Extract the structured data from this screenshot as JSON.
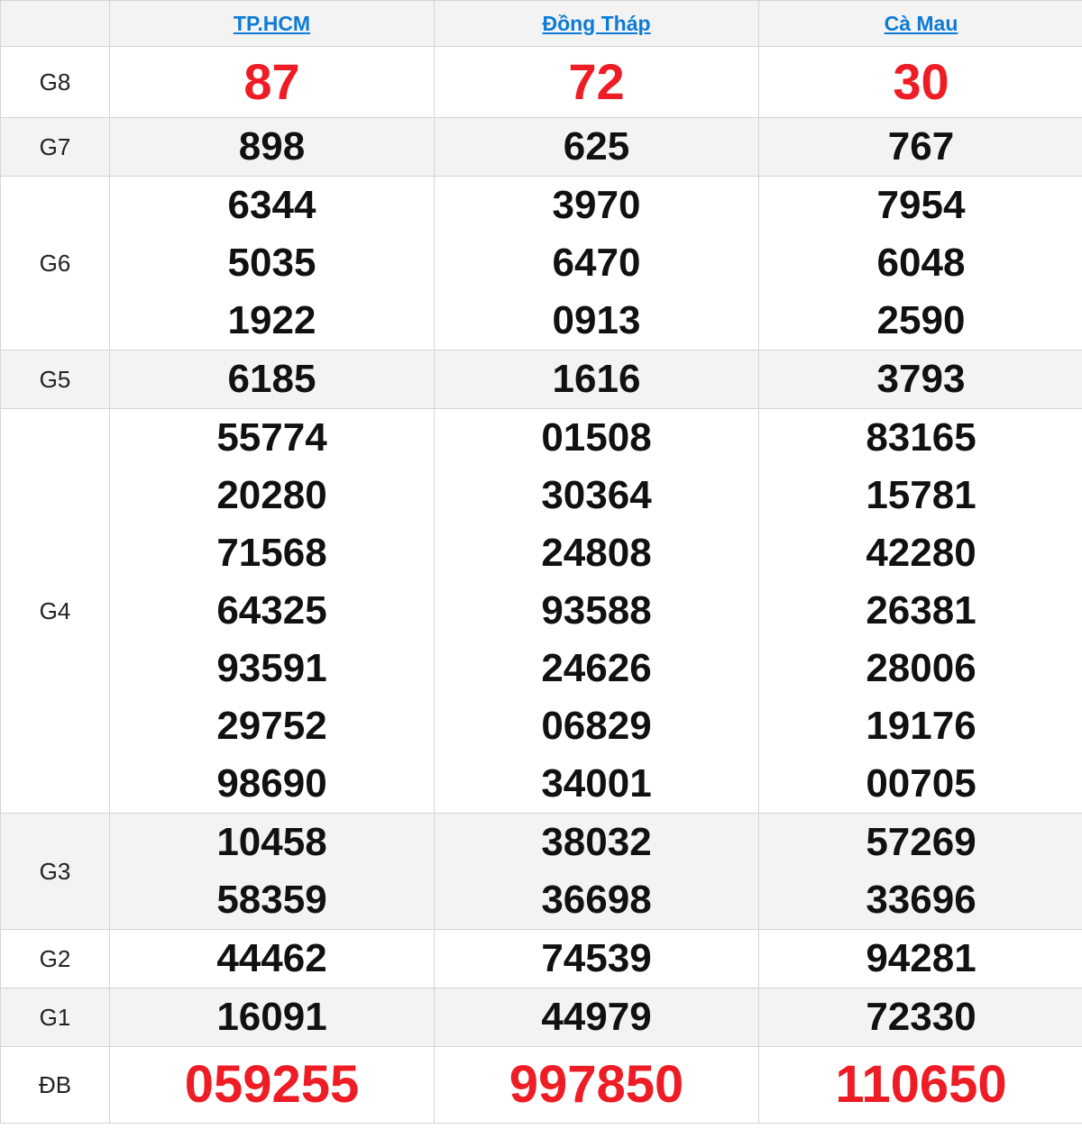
{
  "header": {
    "provinces": [
      "TP.HCM",
      "Đồng Tháp",
      "Cà Mau"
    ]
  },
  "rows": [
    {
      "label": "G8",
      "values": [
        [
          "87"
        ],
        [
          "72"
        ],
        [
          "30"
        ]
      ]
    },
    {
      "label": "G7",
      "values": [
        [
          "898"
        ],
        [
          "625"
        ],
        [
          "767"
        ]
      ]
    },
    {
      "label": "G6",
      "values": [
        [
          "6344",
          "5035",
          "1922"
        ],
        [
          "3970",
          "6470",
          "0913"
        ],
        [
          "7954",
          "6048",
          "2590"
        ]
      ]
    },
    {
      "label": "G5",
      "values": [
        [
          "6185"
        ],
        [
          "1616"
        ],
        [
          "3793"
        ]
      ]
    },
    {
      "label": "G4",
      "values": [
        [
          "55774",
          "20280",
          "71568",
          "64325",
          "93591",
          "29752",
          "98690"
        ],
        [
          "01508",
          "30364",
          "24808",
          "93588",
          "24626",
          "06829",
          "34001"
        ],
        [
          "83165",
          "15781",
          "42280",
          "26381",
          "28006",
          "19176",
          "00705"
        ]
      ]
    },
    {
      "label": "G3",
      "values": [
        [
          "10458",
          "58359"
        ],
        [
          "38032",
          "36698"
        ],
        [
          "57269",
          "33696"
        ]
      ]
    },
    {
      "label": "G2",
      "values": [
        [
          "44462"
        ],
        [
          "74539"
        ],
        [
          "94281"
        ]
      ]
    },
    {
      "label": "G1",
      "values": [
        [
          "16091"
        ],
        [
          "44979"
        ],
        [
          "72330"
        ]
      ]
    },
    {
      "label": "ĐB",
      "values": [
        [
          "059255"
        ],
        [
          "997850"
        ],
        [
          "110650"
        ]
      ]
    }
  ],
  "colors": {
    "link": "#0d7bd6",
    "highlight_red": "#ee1c24",
    "alt_row_bg": "#f3f3f3",
    "border": "#d5d5d5"
  }
}
